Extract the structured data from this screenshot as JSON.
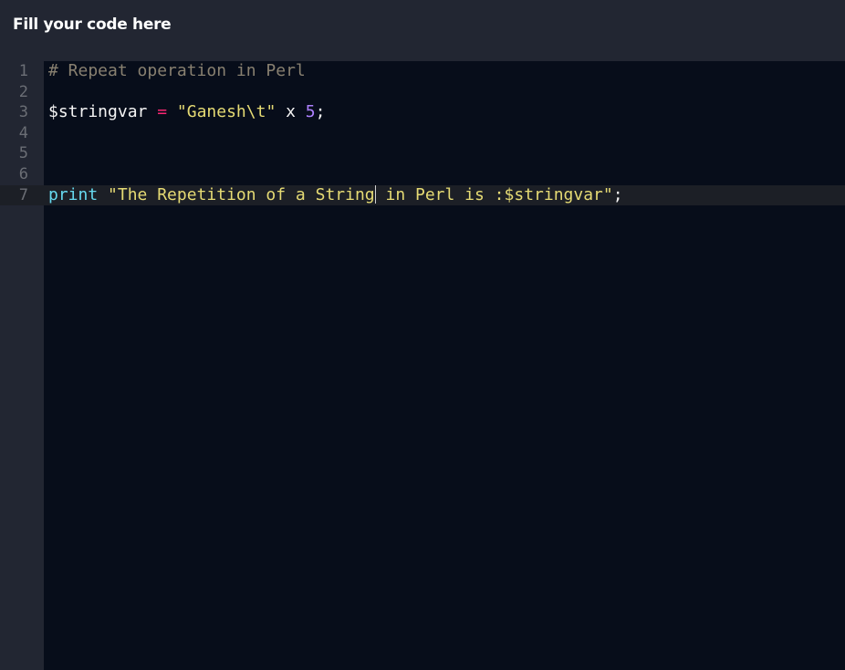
{
  "header": {
    "title": "Fill your code here"
  },
  "editor": {
    "line_numbers": [
      "1",
      "2",
      "3",
      "4",
      "5",
      "6",
      "7"
    ],
    "active_line": 7,
    "lines": {
      "l1": {
        "comment": "# Repeat operation in Perl"
      },
      "l3": {
        "var": "$stringvar",
        "sp1": " ",
        "op": "=",
        "sp2": " ",
        "str": "\"Ganesh\\t\"",
        "mid": " x ",
        "num": "5",
        "end": ";"
      },
      "l7": {
        "kw": "print",
        "sp": " ",
        "str_before_cursor": "\"The Repetition of a String",
        "str_after_cursor": " in Perl is :$stringvar\"",
        "end": ";"
      }
    }
  },
  "colors": {
    "background": "#222632",
    "editor_bg": "#070d1a",
    "comment": "#888070",
    "string": "#e6db74",
    "keyword": "#66d9ef",
    "number": "#ae81ff",
    "operator": "#f92672"
  }
}
